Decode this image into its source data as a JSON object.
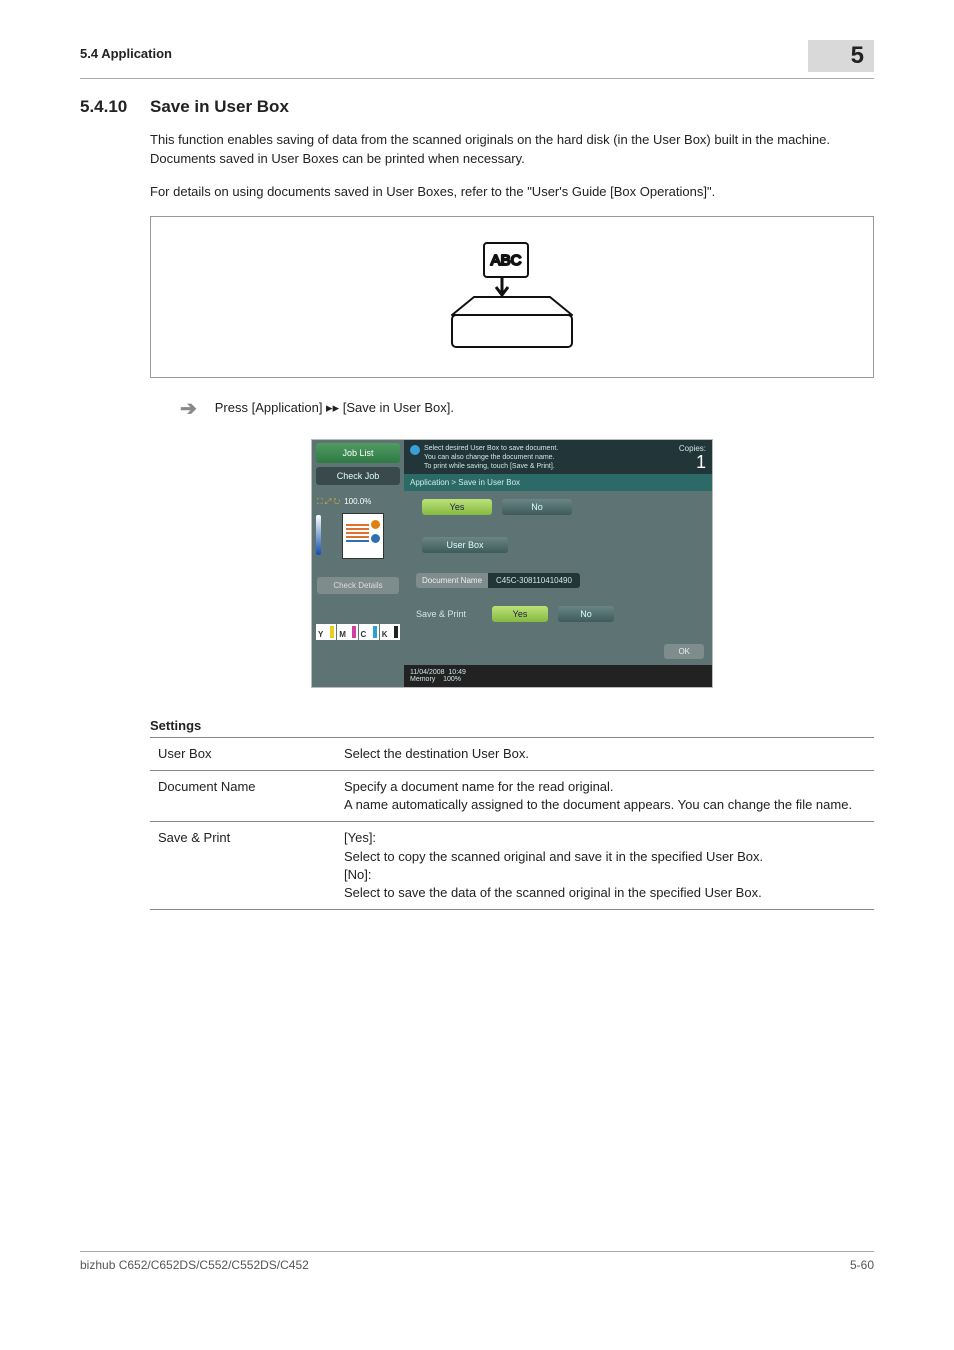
{
  "running_head": {
    "left": "5.4    Application",
    "right_num": "5"
  },
  "section": {
    "number": "5.4.10",
    "title": "Save in User Box"
  },
  "paragraphs": {
    "p1": "This function enables saving of data from the scanned originals on the hard disk (in the User Box) built in the machine. Documents saved in User Boxes can be printed when necessary.",
    "p2": "For details on using documents saved in User Boxes, refer to the \"User's Guide [Box Operations]\"."
  },
  "illustration": {
    "label": "ABC"
  },
  "step": {
    "text": "Press [Application] ▸▸ [Save in User Box]."
  },
  "screenshot": {
    "side": {
      "job_list": "Job List",
      "check_job": "Check Job",
      "zoom_icons": "⛶ ⤢ ↻",
      "zoom_value": "100.0%",
      "check_details": "Check Details"
    },
    "toner": {
      "y": "Y",
      "m": "M",
      "c": "C",
      "k": "K"
    },
    "msg": {
      "l1": "Select desired User Box to save document.",
      "l2": "You can also change the document name.",
      "l3": "To print while saving, touch [Save & Print]."
    },
    "copies_label": "Copies:",
    "copies_value": "1",
    "breadcrumb": "Application > Save in User Box",
    "yes": "Yes",
    "no": "No",
    "user_box": "User Box",
    "doc_name_label": "Document Name",
    "doc_name_value": "C45C-308110410490",
    "save_print": "Save & Print",
    "ok": "OK",
    "status_date": "11/04/2008",
    "status_time": "10:49",
    "status_mem_l": "Memory",
    "status_mem_v": "100%"
  },
  "settings": {
    "heading": "Settings",
    "rows": [
      {
        "k": "User Box",
        "v": "Select the destination User Box."
      },
      {
        "k": "Document Name",
        "v": "Specify a document name for the read original.\nA name automatically assigned to the document appears. You can change the file name."
      },
      {
        "k": "Save & Print",
        "v": "[Yes]:\nSelect to copy the scanned original and save it in the specified User Box.\n[No]:\nSelect to save the data of the scanned original in the specified User Box."
      }
    ]
  },
  "footer": {
    "left": "bizhub C652/C652DS/C552/C552DS/C452",
    "right": "5-60"
  }
}
